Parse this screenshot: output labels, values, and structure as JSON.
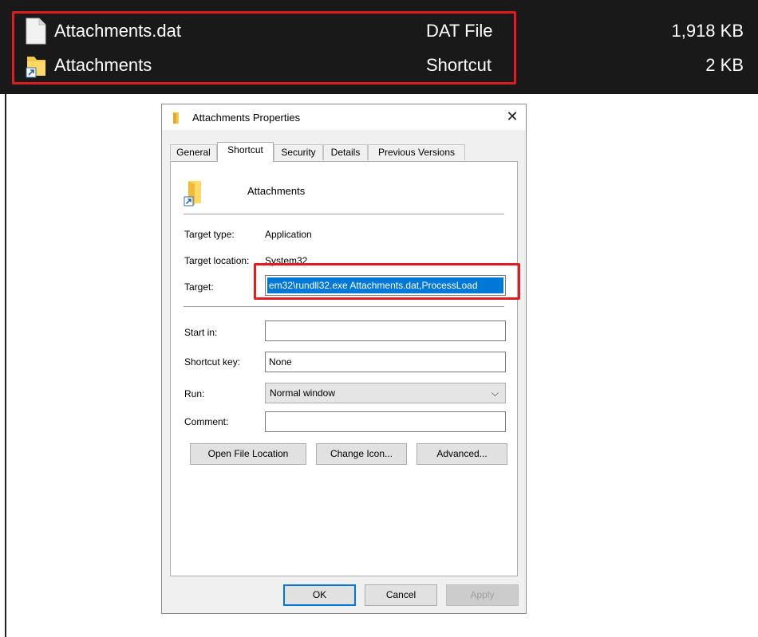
{
  "explorer": {
    "rows": [
      {
        "name": "Attachments.dat",
        "type": "DAT File",
        "size": "1,918 KB",
        "icon": "document-icon"
      },
      {
        "name": "Attachments",
        "type": "Shortcut",
        "size": "2 KB",
        "icon": "folder-shortcut-icon"
      }
    ],
    "highlight_color": "#e11b22"
  },
  "dialog": {
    "title": "Attachments Properties",
    "close_glyph": "✕",
    "tabs": [
      "General",
      "Shortcut",
      "Security",
      "Details",
      "Previous Versions"
    ],
    "active_tab": "Shortcut",
    "shortcut_name": "Attachments",
    "fields": {
      "target_type_label": "Target type:",
      "target_type_value": "Application",
      "target_location_label": "Target location:",
      "target_location_value": "System32",
      "target_label": "Target:",
      "target_value": "em32\\rundll32.exe Attachments.dat,ProcessLoad",
      "start_in_label": "Start in:",
      "start_in_value": "",
      "shortcut_key_label": "Shortcut key:",
      "shortcut_key_value": "None",
      "run_label": "Run:",
      "run_value": "Normal window",
      "comment_label": "Comment:",
      "comment_value": ""
    },
    "buttons": {
      "open_file_location": "Open File Location",
      "change_icon": "Change Icon...",
      "advanced": "Advanced...",
      "ok": "OK",
      "cancel": "Cancel",
      "apply": "Apply"
    },
    "colors": {
      "selection": "#0078d7",
      "highlight": "#e11b22"
    }
  }
}
